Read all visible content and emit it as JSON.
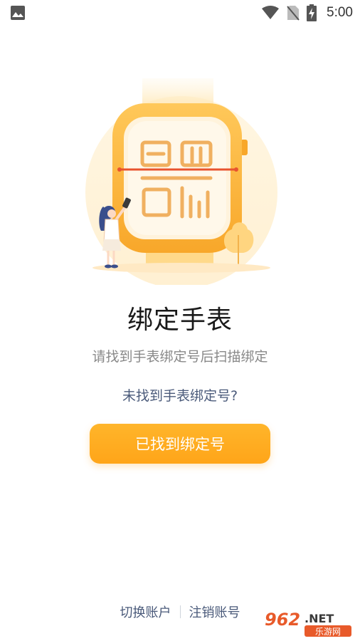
{
  "status_bar": {
    "time": "5:00",
    "icons": [
      "image-notification-icon",
      "wifi-icon",
      "no-sim-icon",
      "battery-charging-icon"
    ]
  },
  "main": {
    "illustration": "watch-qr-scan-illustration",
    "title": "绑定手表",
    "subtitle": "请找到手表绑定号后扫描绑定",
    "not_found_link": "未找到手表绑定号?",
    "primary_button": "已找到绑定号"
  },
  "footer": {
    "switch_account": "切换账户",
    "cancel_account": "注销账号"
  },
  "watermark": {
    "number": "962",
    "suffix": ".NET",
    "site": "乐游网"
  },
  "colors": {
    "accent": "#FFA519",
    "link": "#4a5a7a",
    "subtitle": "#888888",
    "title": "#1a1a1a"
  }
}
